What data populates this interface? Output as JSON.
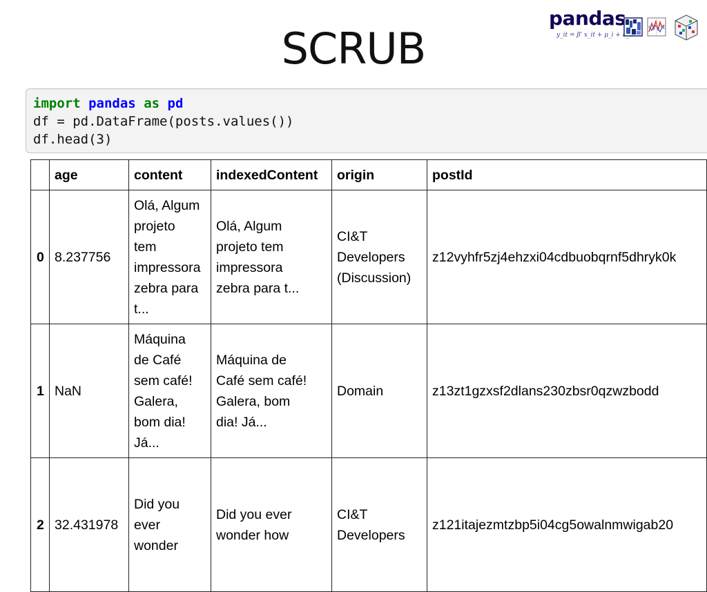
{
  "slide": {
    "title": "SCRUB"
  },
  "logo": {
    "word": "pandas",
    "formula": "y_it = β' x_it + μ_i + ε_it",
    "icons": [
      "matrix-heatmap-icon",
      "timeseries-grid-icon",
      "3d-cube-icon"
    ]
  },
  "code": {
    "kw_import": "import",
    "mod_pandas": "pandas",
    "kw_as": "as",
    "alias_pd": "pd",
    "line2": "df = pd.DataFrame(posts.values())",
    "line3_prefix": "df.head(",
    "line3_arg": "3",
    "line3_suffix": ")"
  },
  "table": {
    "index_header": "",
    "headers": [
      "age",
      "content",
      "indexedContent",
      "origin",
      "postId"
    ],
    "rows": [
      {
        "index": "0",
        "age": "8.237756",
        "content": [
          "Olá, Algum",
          "projeto",
          "tem",
          "impressora",
          "zebra para",
          "t..."
        ],
        "indexedContent": [
          "Olá, Algum",
          "projeto tem",
          "impressora",
          "zebra para t..."
        ],
        "origin": [
          "CI&T",
          "Developers",
          "(Discussion)"
        ],
        "postId": "z12vyhfr5zj4ehzxi04cdbuobqrnf5dhryk0k"
      },
      {
        "index": "1",
        "age": "NaN",
        "content": [
          "Máquina",
          "de Café",
          "sem café!",
          "Galera,",
          "bom dia!",
          "Já..."
        ],
        "indexedContent": [
          "Máquina de",
          "Café sem café!",
          "Galera, bom",
          "dia!  Já..."
        ],
        "origin": [
          "Domain"
        ],
        "postId": "z13zt1gzxsf2dlans230zbsr0qzwzbodd"
      },
      {
        "index": "2",
        "age": "32.431978",
        "content": [
          "Did you",
          "ever",
          "wonder"
        ],
        "indexedContent": [
          "Did you ever",
          "wonder how"
        ],
        "origin": [
          "CI&T",
          "Developers"
        ],
        "postId": "z121itajezmtzbp5i04cg5owalnmwigab20"
      }
    ]
  }
}
